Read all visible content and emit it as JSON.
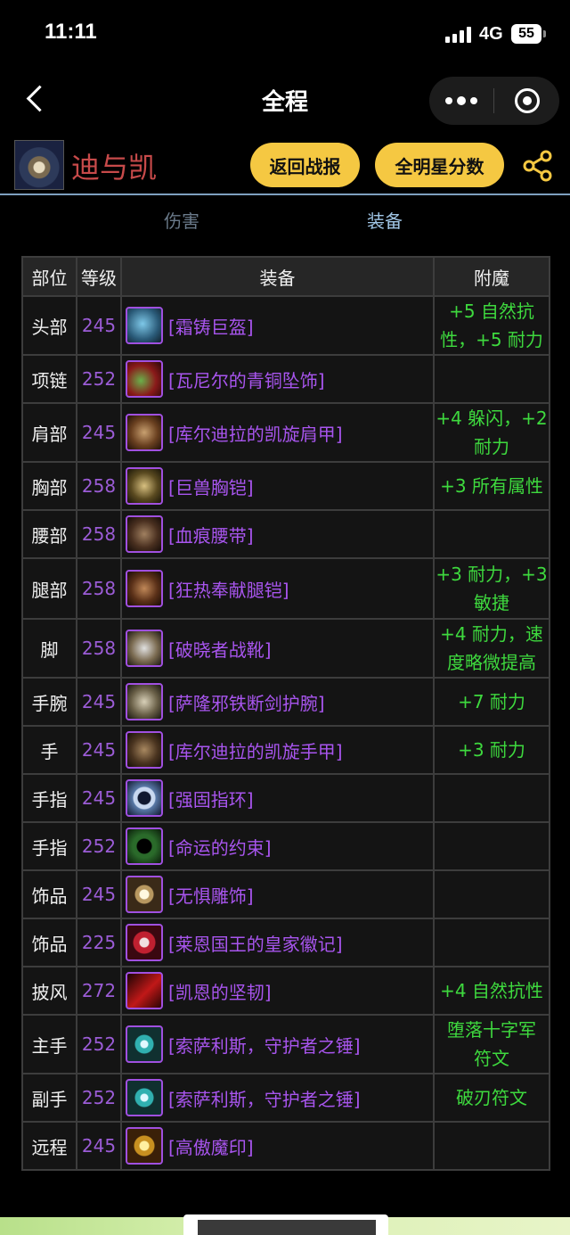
{
  "status": {
    "time": "11:11",
    "network": "4G",
    "battery": "55"
  },
  "nav": {
    "title": "全程"
  },
  "header": {
    "character_name": "迪与凯",
    "btn_back_report": "返回战报",
    "btn_allstar": "全明星分数"
  },
  "tabs": [
    {
      "label": "伤害",
      "active": false
    },
    {
      "label": "装备",
      "active": true
    }
  ],
  "table": {
    "headers": [
      "部位",
      "等级",
      "装备",
      "附魔"
    ],
    "rows": [
      {
        "slot": "头部",
        "level": "245",
        "item": "[霜铸巨盔]",
        "ench": [
          "+5 自然抗",
          "性，+5 耐力"
        ]
      },
      {
        "slot": "项链",
        "level": "252",
        "item": "[瓦尼尔的青铜坠饰]",
        "ench": []
      },
      {
        "slot": "肩部",
        "level": "245",
        "item": "[库尔迪拉的凯旋肩甲]",
        "ench": [
          "+4 躲闪，+2",
          "耐力"
        ]
      },
      {
        "slot": "胸部",
        "level": "258",
        "item": "[巨兽胸铠]",
        "ench": [
          "+3 所有属性"
        ]
      },
      {
        "slot": "腰部",
        "level": "258",
        "item": "[血痕腰带]",
        "ench": []
      },
      {
        "slot": "腿部",
        "level": "258",
        "item": "[狂热奉献腿铠]",
        "ench": [
          "+3 耐力，+3",
          "敏捷"
        ]
      },
      {
        "slot": "脚",
        "level": "258",
        "item": "[破晓者战靴]",
        "ench": [
          "+4 耐力，速",
          "度略微提高"
        ]
      },
      {
        "slot": "手腕",
        "level": "245",
        "item": "[萨隆邪铁断剑护腕]",
        "ench": [
          "+7 耐力"
        ]
      },
      {
        "slot": "手",
        "level": "245",
        "item": "[库尔迪拉的凯旋手甲]",
        "ench": [
          "+3 耐力"
        ]
      },
      {
        "slot": "手指",
        "level": "245",
        "item": "[强固指环]",
        "ench": []
      },
      {
        "slot": "手指",
        "level": "252",
        "item": "[命运的约束]",
        "ench": []
      },
      {
        "slot": "饰品",
        "level": "245",
        "item": "[无惧雕饰]",
        "ench": []
      },
      {
        "slot": "饰品",
        "level": "225",
        "item": "[莱恩国王的皇家徽记]",
        "ench": []
      },
      {
        "slot": "披风",
        "level": "272",
        "item": "[凯恩的坚韧]",
        "ench": [
          "+4 自然抗性"
        ]
      },
      {
        "slot": "主手",
        "level": "252",
        "item": "[索萨利斯，守护者之锤]",
        "ench": [
          "堕落十字军",
          "符文"
        ]
      },
      {
        "slot": "副手",
        "level": "252",
        "item": "[索萨利斯，守护者之锤]",
        "ench": [
          "破刃符文"
        ]
      },
      {
        "slot": "远程",
        "level": "245",
        "item": "[高傲魔印]",
        "ench": []
      }
    ]
  },
  "colors": {
    "accent_yellow": "#f5c842",
    "epic_purple": "#a855ee",
    "enchant_green": "#3ed93e",
    "name_red": "#c74a4a"
  },
  "icons": [
    "helmet-icon",
    "necklace-icon",
    "shoulder-icon",
    "chest-icon",
    "belt-icon",
    "legs-icon",
    "boots-icon",
    "bracer-icon",
    "gloves-icon",
    "ring-icon",
    "ring-icon",
    "trinket-icon",
    "trinket-icon",
    "cloak-icon",
    "mace-icon",
    "mace-icon",
    "relic-icon"
  ]
}
